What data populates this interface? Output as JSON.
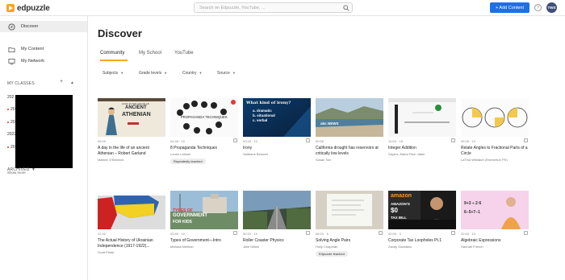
{
  "app": {
    "logo_text": "edpuzzle"
  },
  "topbar": {
    "search_placeholder": "Search on Edpuzzle, YouTube, ...",
    "add_content_label": "+ Add Content",
    "help_label": "?",
    "avatar_initials": "TWS"
  },
  "sidebar": {
    "discover_label": "Discover",
    "my_content_label": "My Content",
    "my_network_label": "My Network",
    "my_classes_label": "MY CLASSES",
    "classes": [
      "202",
      "20",
      "20",
      "2022",
      "20"
    ],
    "show_more_label": "Show more",
    "archived_label": "ARCHIVED"
  },
  "main": {
    "title": "Discover",
    "tabs": [
      "Community",
      "My School",
      "YouTube"
    ],
    "filters": [
      "Subjects",
      "Grade levels",
      "Country",
      "Source"
    ]
  },
  "videos": [
    {
      "duration": "05:09",
      "title": "A day in the life of an ancient Athenian – Robert Garland",
      "author": "Maisee G’Bennick",
      "tag": ""
    },
    {
      "duration": "04:46",
      "questions": "10",
      "title": "8 Propaganda Techniques",
      "author": "Lonee Leibrek",
      "tag": "Repeatedly teached"
    },
    {
      "duration": "00:45",
      "questions": "10",
      "title": "Irony",
      "author": "Salthane Bennett",
      "tag": ""
    },
    {
      "duration": "00:56",
      "title": "California drought has reservoirs at critically low levels",
      "author": "Susan Tan",
      "tag": ""
    },
    {
      "duration": "10:00",
      "questions": "15",
      "title": "Integer Addition",
      "author": "Sayers, Maria Fitch Jabel",
      "tag": ""
    },
    {
      "duration": "05:28",
      "questions": "10",
      "title": "Relate Angles to Fractional Parts of a Circle",
      "author": "LaTina Whitaker (Emmerton PS)",
      "tag": ""
    },
    {
      "duration": "22:30",
      "title": "The Actual History of Ukrainian Independence (1917-1922)...",
      "author": "Scott Pelak",
      "tag": ""
    },
    {
      "duration": "00:46",
      "questions": "10",
      "title": "Types of Government—Intro",
      "author": "Melissa Meilhan",
      "tag": ""
    },
    {
      "duration": "00:20",
      "questions": "10",
      "title": "Roller Coaster Physics",
      "author": "Julie Dillow",
      "tag": ""
    },
    {
      "duration": "08:23",
      "questions": "5",
      "title": "Solving Angle Pairs",
      "author": "Holly Chapman",
      "tag": "Edpuzzle teached"
    },
    {
      "duration": "02:09",
      "questions": "3",
      "title": "Corporate Tax Loopholes Pt.1",
      "author": "Zandy Gavidano",
      "tag": ""
    },
    {
      "duration": "02:00",
      "questions": "10",
      "title": "Algebraic Expressions",
      "author": "Hannah French",
      "tag": ""
    }
  ],
  "thumb_text": {
    "t0_line1": "A DAY IN THE LIFE OF AN",
    "t0_line2": "ANCIENT",
    "t0_line3": "ATHENIAN",
    "t1": "PROPAGANDA TECHNIQUES",
    "t2_q": "What kind of irony?",
    "t2_a": "a. dramatic",
    "t2_b": "b. situational",
    "t2_c": "c. verbal",
    "t3": "abc NEWS",
    "t7_l1": "TYPES OF",
    "t7_l2": "GOVERNMENT",
    "t7_l3": "FOR KIDS",
    "t10_l1": "amazon",
    "t10_l2": "AMAZON'S",
    "t10_l3": "$0",
    "t10_l4": "TAX BILL",
    "t11_l1": "9+3 ÷ 2·6",
    "t11_l2": "6−5+7−1"
  }
}
